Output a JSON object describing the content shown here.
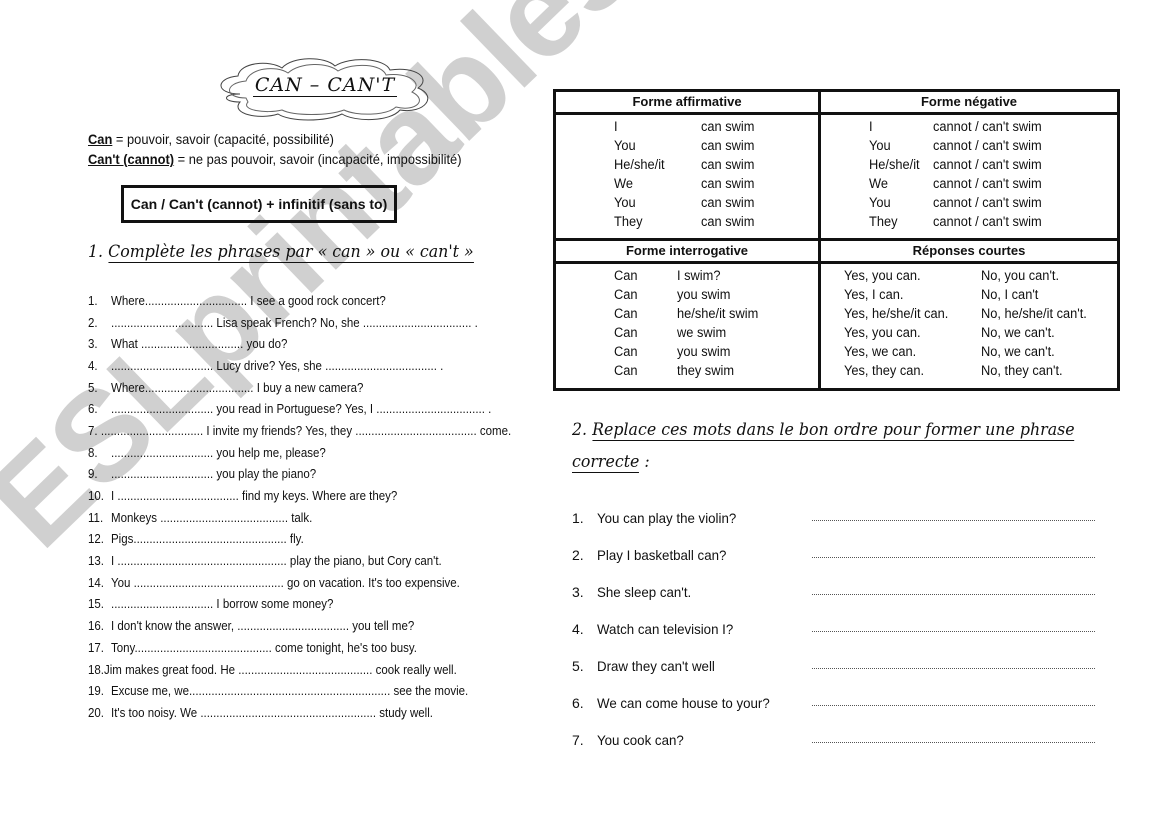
{
  "title": "CAN – CAN'T",
  "definitions": [
    {
      "term": "Can",
      "meaning": " = pouvoir, savoir (capacité, possibilité)"
    },
    {
      "term": "Can't  (cannot)",
      "meaning": " = ne pas pouvoir, savoir (incapacité, impossibilité)"
    }
  ],
  "rule": "Can / Can't (cannot) + infinitif (sans to)",
  "exercise1": {
    "heading_number": "1. ",
    "heading": "Complète les phrases par « can » ou « can't »",
    "items": [
      {
        "num": "1.",
        "text": "Where................................ I see a good rock concert?"
      },
      {
        "num": "2.",
        "text": "................................ Lisa speak French?  No, she  ..................................  ."
      },
      {
        "num": "3.",
        "text": "What ................................  you do?"
      },
      {
        "num": "4.",
        "text": "................................ Lucy drive?  Yes, she  ...................................  ."
      },
      {
        "num": "5.",
        "text": "Where.................................. I buy a new camera?"
      },
      {
        "num": "6.",
        "text": "................................ you read in Portuguese?  Yes, I ..................................  ."
      },
      {
        "num": "7.",
        "text": "................................ I invite my friends?  Yes, they ...................................... come."
      },
      {
        "num": "8.",
        "text": "................................ you help me, please?"
      },
      {
        "num": "9.",
        "text": "................................ you play the piano?"
      },
      {
        "num": "10.",
        "text": "I ...................................... find my keys.  Where are they?"
      },
      {
        "num": "11.",
        "text": "Monkeys ........................................ talk."
      },
      {
        "num": "12.",
        "text": "Pigs................................................ fly."
      },
      {
        "num": "13.",
        "text": "I ..................................................... play the piano, but Cory can't."
      },
      {
        "num": "14.",
        "text": "You  ............................................... go on vacation.  It's too expensive."
      },
      {
        "num": "15.",
        "text": "................................ I borrow some money?"
      },
      {
        "num": "16.",
        "text": "I don't know the answer,  ................................... you tell me?"
      },
      {
        "num": "17.",
        "text": "Tony........................................... come tonight, he's too busy."
      },
      {
        "num": "18.",
        "text": "Jim makes great food.  He  .......................................... cook really well."
      },
      {
        "num": "19.",
        "text": "Excuse me, we............................................................... see the movie."
      },
      {
        "num": "20.",
        "text": "It's too noisy.  We  ....................................................... study well."
      }
    ]
  },
  "grammar_table": {
    "affirmative": {
      "header": "Forme affirmative",
      "rows": [
        {
          "subject": "I",
          "verb": "can swim"
        },
        {
          "subject": "You",
          "verb": "can swim"
        },
        {
          "subject": "He/she/it",
          "verb": "can swim"
        },
        {
          "subject": "We",
          "verb": "can swim"
        },
        {
          "subject": "You",
          "verb": "can swim"
        },
        {
          "subject": "They",
          "verb": "can swim"
        }
      ]
    },
    "negative": {
      "header": "Forme négative",
      "rows": [
        {
          "subject": "I",
          "verb": "cannot / can't swim"
        },
        {
          "subject": "You",
          "verb": "cannot / can't swim"
        },
        {
          "subject": "He/she/it",
          "verb": "cannot / can't swim"
        },
        {
          "subject": "We",
          "verb": "cannot / can't swim"
        },
        {
          "subject": "You",
          "verb": "cannot / can't swim"
        },
        {
          "subject": "They",
          "verb": "cannot / can't swim"
        }
      ]
    },
    "interrogative": {
      "header": "Forme interrogative",
      "rows": [
        {
          "modal": "Can",
          "rest": "I swim?"
        },
        {
          "modal": "Can",
          "rest": "you swim"
        },
        {
          "modal": "Can",
          "rest": "he/she/it swim"
        },
        {
          "modal": "Can",
          "rest": "we swim"
        },
        {
          "modal": "Can",
          "rest": "you swim"
        },
        {
          "modal": "Can",
          "rest": "they swim"
        }
      ]
    },
    "short_answers": {
      "header": "Réponses courtes",
      "rows": [
        {
          "yes": "Yes, you can.",
          "no": "No, you can't."
        },
        {
          "yes": "Yes, I can.",
          "no": "No, I can't"
        },
        {
          "yes": "Yes, he/she/it can.",
          "no": "No, he/she/it can't."
        },
        {
          "yes": "Yes, you can.",
          "no": "No, we can't."
        },
        {
          "yes": "Yes, we can.",
          "no": "No, we can't."
        },
        {
          "yes": "Yes, they can.",
          "no": "No, they can't."
        }
      ]
    }
  },
  "exercise2": {
    "heading_number": "2. ",
    "heading_line1": "Replace ces mots dans le bon ordre pour former une phrase",
    "heading_line2": "correcte",
    "heading_suffix": " :",
    "items": [
      {
        "num": "1.",
        "text": "You can play the violin?"
      },
      {
        "num": "2.",
        "text": "Play I basketball can?"
      },
      {
        "num": "3.",
        "text": "She sleep can't."
      },
      {
        "num": "4.",
        "text": "Watch can television I?"
      },
      {
        "num": "5.",
        "text": "Draw they can't well"
      },
      {
        "num": "6.",
        "text": "We can come house to your?"
      },
      {
        "num": "7.",
        "text": "You cook can?"
      }
    ]
  },
  "watermark": "ESLprintables.com",
  "colors": {
    "text": "#111111",
    "watermark": "#c8c8c8",
    "background": "#ffffff"
  }
}
